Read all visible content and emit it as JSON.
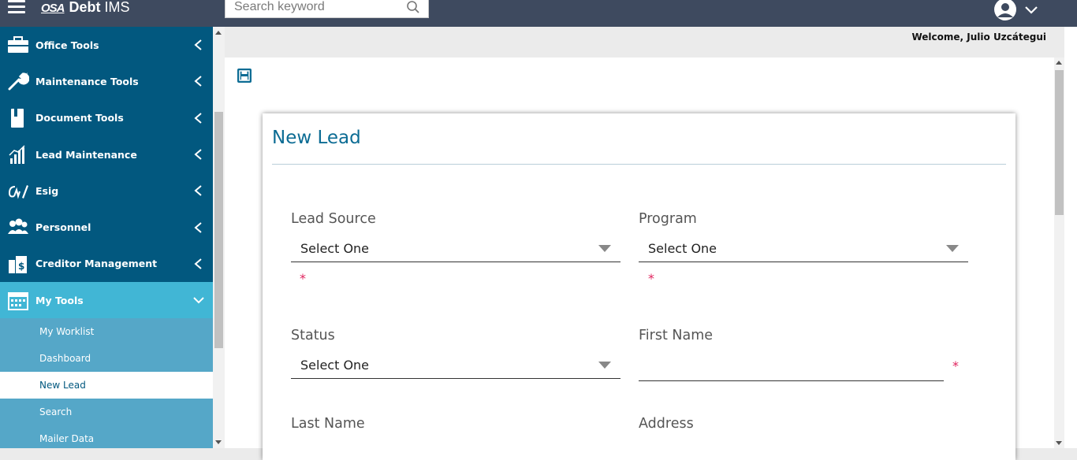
{
  "app": {
    "brand": "OSA",
    "title_bold": "Debt",
    "title_rest": "IMS"
  },
  "search": {
    "placeholder": "Search keyword",
    "value": ""
  },
  "user": {
    "welcome": "Welcome, Julio Uzcátegui"
  },
  "sidebar": {
    "items": [
      {
        "label": "Office Tools",
        "icon": "briefcase-icon",
        "expanded": false
      },
      {
        "label": "Maintenance Tools",
        "icon": "wrench-icon",
        "expanded": false
      },
      {
        "label": "Document Tools",
        "icon": "book-icon",
        "expanded": false
      },
      {
        "label": "Lead Maintenance",
        "icon": "chart-icon",
        "expanded": false
      },
      {
        "label": "Esig",
        "icon": "signature-icon",
        "expanded": false
      },
      {
        "label": "Personnel",
        "icon": "people-icon",
        "expanded": false
      },
      {
        "label": "Creditor Management",
        "icon": "building-icon",
        "expanded": false
      },
      {
        "label": "My Tools",
        "icon": "calendar-icon",
        "expanded": true
      }
    ],
    "subitems": [
      {
        "label": "My Worklist"
      },
      {
        "label": "Dashboard"
      },
      {
        "label": "New Lead",
        "current": true
      },
      {
        "label": "Search"
      },
      {
        "label": "Mailer Data"
      }
    ]
  },
  "form": {
    "title": "New Lead",
    "fields": {
      "lead_source": {
        "label": "Lead Source",
        "value": "Select One",
        "required": "*"
      },
      "program": {
        "label": "Program",
        "value": "Select One",
        "required": "*"
      },
      "status": {
        "label": "Status",
        "value": "Select One"
      },
      "first_name": {
        "label": "First Name",
        "value": "",
        "required": "*"
      },
      "last_name": {
        "label": "Last Name"
      },
      "address": {
        "label": "Address"
      }
    }
  },
  "colors": {
    "topbar": "#3e4a5f",
    "sidebar": "#02587f",
    "sidebar_active": "#41b6d5",
    "title": "#0c6c94",
    "required": "#e0245e"
  }
}
